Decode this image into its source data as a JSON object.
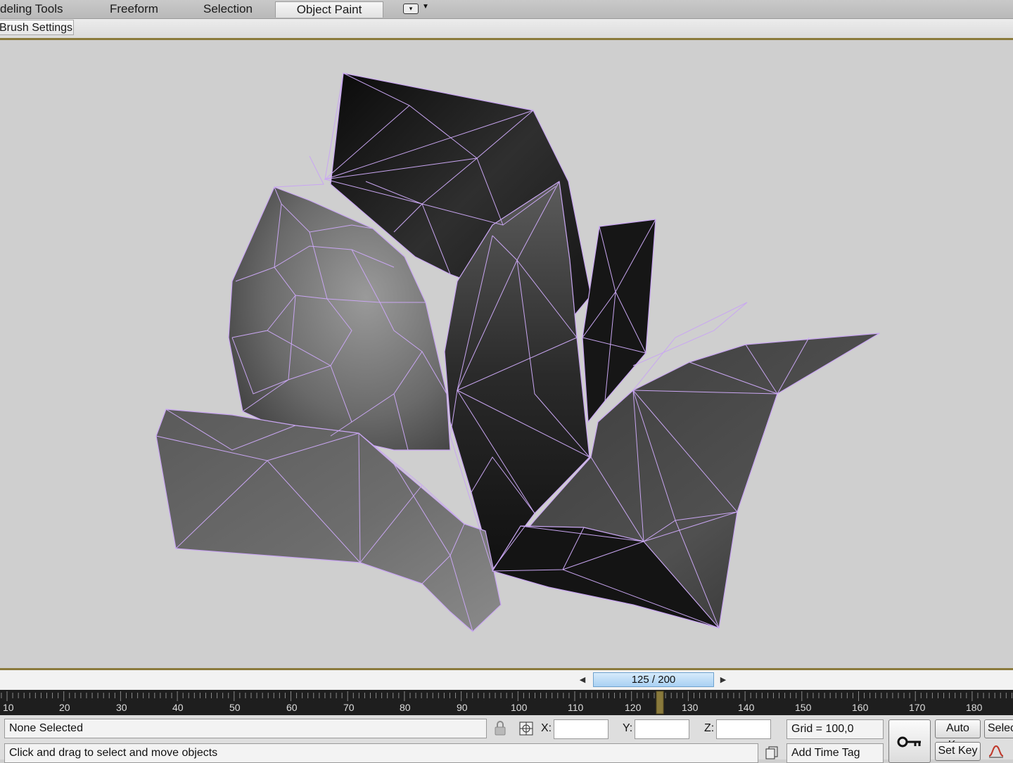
{
  "ribbon": {
    "tabs": [
      {
        "label": "deling Tools"
      },
      {
        "label": "Freeform"
      },
      {
        "label": "Selection"
      },
      {
        "label": "Object Paint"
      }
    ],
    "active_tab": "Object Paint"
  },
  "subbar": {
    "brush_settings_label": "Brush Settings"
  },
  "timeline": {
    "slider_label": "125 / 200",
    "current_frame": 125,
    "total_frames": 200,
    "tick_labels": [
      "10",
      "20",
      "30",
      "40",
      "50",
      "60",
      "70",
      "80",
      "90",
      "100",
      "110",
      "120",
      "130",
      "140",
      "150",
      "160",
      "170",
      "180"
    ]
  },
  "status": {
    "selection_text": "None Selected",
    "prompt_text": "Click and drag to select and move objects",
    "x_label": "X:",
    "y_label": "Y:",
    "z_label": "Z:",
    "x_value": "",
    "y_value": "",
    "z_value": "",
    "grid_text": "Grid = 100,0",
    "add_time_tag_label": "Add Time Tag",
    "auto_key_label": "Auto Key",
    "set_key_label": "Set Key",
    "selected_label": "Selec"
  },
  "colors": {
    "wireframe": "#c9a6f2",
    "viewport_border": "#8a7a3c",
    "time_slider": "#a9d1f3"
  }
}
